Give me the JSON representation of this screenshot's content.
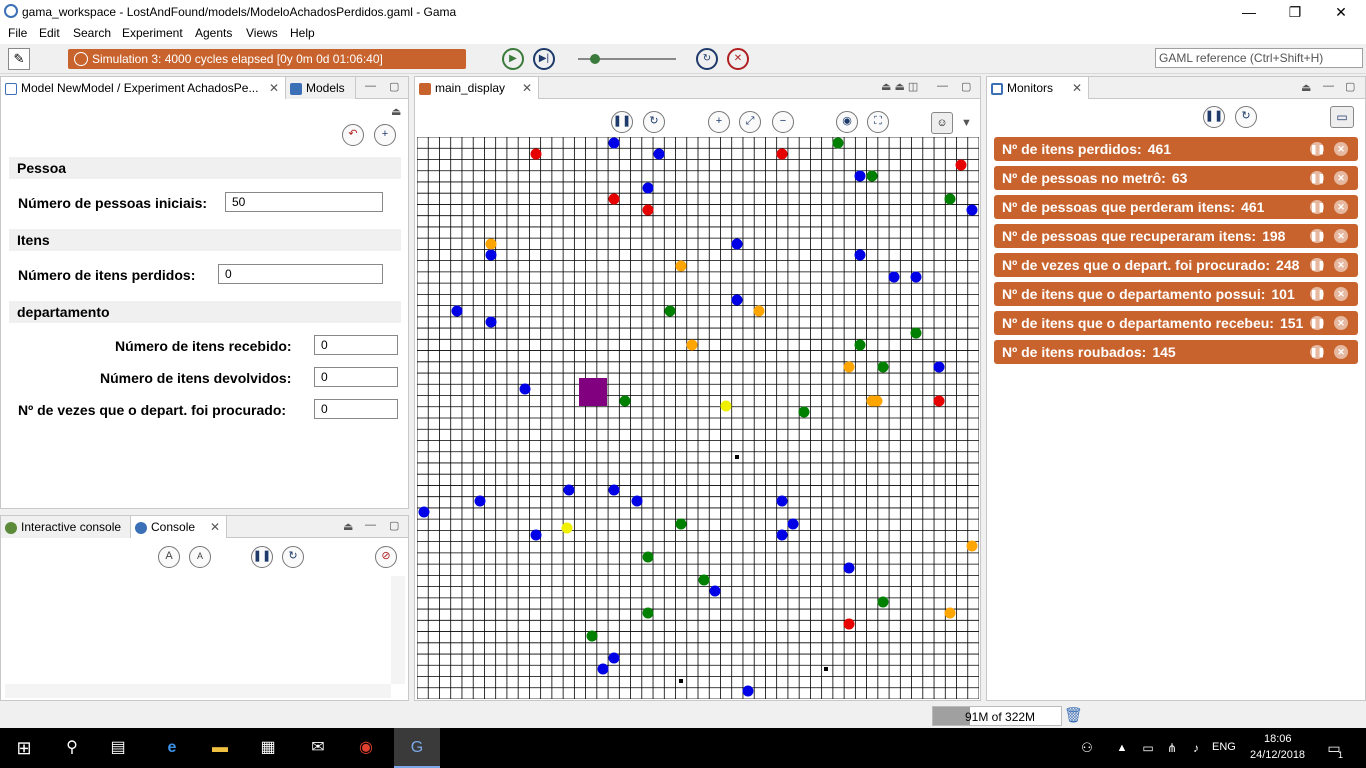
{
  "window": {
    "title": "gama_workspace - LostAndFound/models/ModeloAchadosPerdidos.gaml - Gama",
    "minimize": "—",
    "maximize": "❐",
    "close": "✕"
  },
  "menu": [
    "File",
    "Edit",
    "Search",
    "Experiment",
    "Agents",
    "Views",
    "Help"
  ],
  "toolbar": {
    "simulation_status": "Simulation 3: 4000 cycles elapsed [0y 0m 0d 01:06:40]",
    "search_placeholder": "GAML reference (Ctrl+Shift+H)"
  },
  "left_panel": {
    "tab1": "Model NewModel / Experiment AchadosPe...",
    "tab2": "Models",
    "sections": [
      {
        "title": "Pessoa",
        "label": "Número de pessoas iniciais:",
        "value": "50"
      },
      {
        "title": "Itens",
        "label": "Número de itens perdidos:",
        "value": "0"
      }
    ],
    "dept": {
      "title": "departamento",
      "rows": [
        {
          "label": "Número de itens recebido:",
          "value": "0"
        },
        {
          "label": "Número de itens devolvidos:",
          "value": "0"
        },
        {
          "label": "Nº de vezes que o depart. foi procurado:",
          "value": "0"
        }
      ]
    }
  },
  "console": {
    "tab1": "Interactive console",
    "tab2": "Console"
  },
  "display": {
    "tab": "main_display",
    "grid_cells": 50,
    "agents": {
      "colors": {
        "red": "#e60000",
        "blue": "#0000e6",
        "green": "#008000",
        "orange": "#ffa500",
        "yellow": "#f0f000",
        "purple": "#800080"
      }
    }
  },
  "monitors": {
    "tab": "Monitors",
    "items": [
      {
        "label": "Nº de itens perdidos:",
        "value": "461"
      },
      {
        "label": "Nº de pessoas no metrô:",
        "value": "63"
      },
      {
        "label": "Nº de pessoas que perderam itens:",
        "value": "461"
      },
      {
        "label": "Nº de pessoas que recuperaram itens:",
        "value": "198"
      },
      {
        "label": "Nº de vezes que o depart. foi procurado:",
        "value": "248"
      },
      {
        "label": "Nº de itens que o departamento possui:",
        "value": "101"
      },
      {
        "label": "Nº de itens que o departamento recebeu:",
        "value": "151"
      },
      {
        "label": "Nº de itens roubados:",
        "value": "145"
      }
    ]
  },
  "status": {
    "memory": "91M of 322M"
  },
  "taskbar": {
    "lang": "ENG",
    "time": "18:06",
    "date": "24/12/2018",
    "notifications": "1"
  }
}
